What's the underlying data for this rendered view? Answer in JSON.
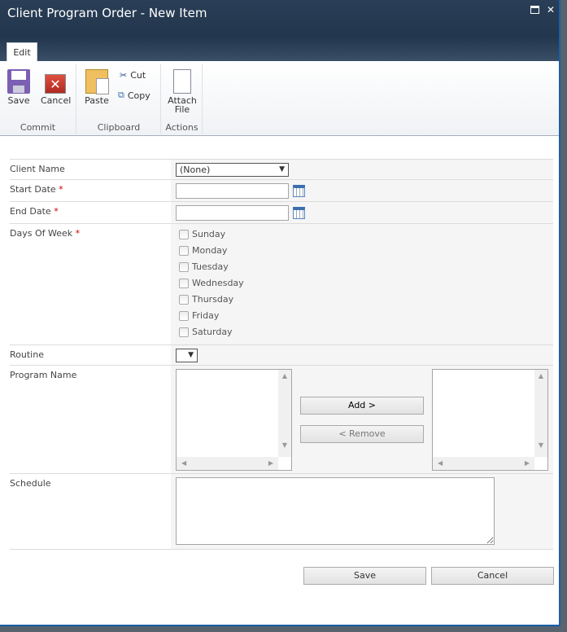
{
  "window": {
    "title": "Client Program Order - New Item",
    "maximize_icon": "maximize-icon",
    "close_icon": "close-icon"
  },
  "ribbon": {
    "tab": "Edit",
    "commit": {
      "label": "Commit",
      "save": "Save",
      "cancel": "Cancel"
    },
    "clipboard": {
      "label": "Clipboard",
      "paste": "Paste",
      "cut": "Cut",
      "copy": "Copy"
    },
    "actions": {
      "label": "Actions",
      "attach1": "Attach",
      "attach2": "File"
    }
  },
  "form": {
    "client_name": {
      "label": "Client Name",
      "value": "(None)"
    },
    "start_date": {
      "label": "Start Date",
      "required": "*",
      "value": ""
    },
    "end_date": {
      "label": "End Date",
      "required": "*",
      "value": ""
    },
    "days": {
      "label": "Days Of Week",
      "required": "*",
      "options": [
        "Sunday",
        "Monday",
        "Tuesday",
        "Wednesday",
        "Thursday",
        "Friday",
        "Saturday"
      ]
    },
    "routine": {
      "label": "Routine",
      "value": ""
    },
    "program_name": {
      "label": "Program Name",
      "add": "Add >",
      "remove": "< Remove"
    },
    "schedule": {
      "label": "Schedule",
      "value": ""
    }
  },
  "footer": {
    "save": "Save",
    "cancel": "Cancel"
  }
}
